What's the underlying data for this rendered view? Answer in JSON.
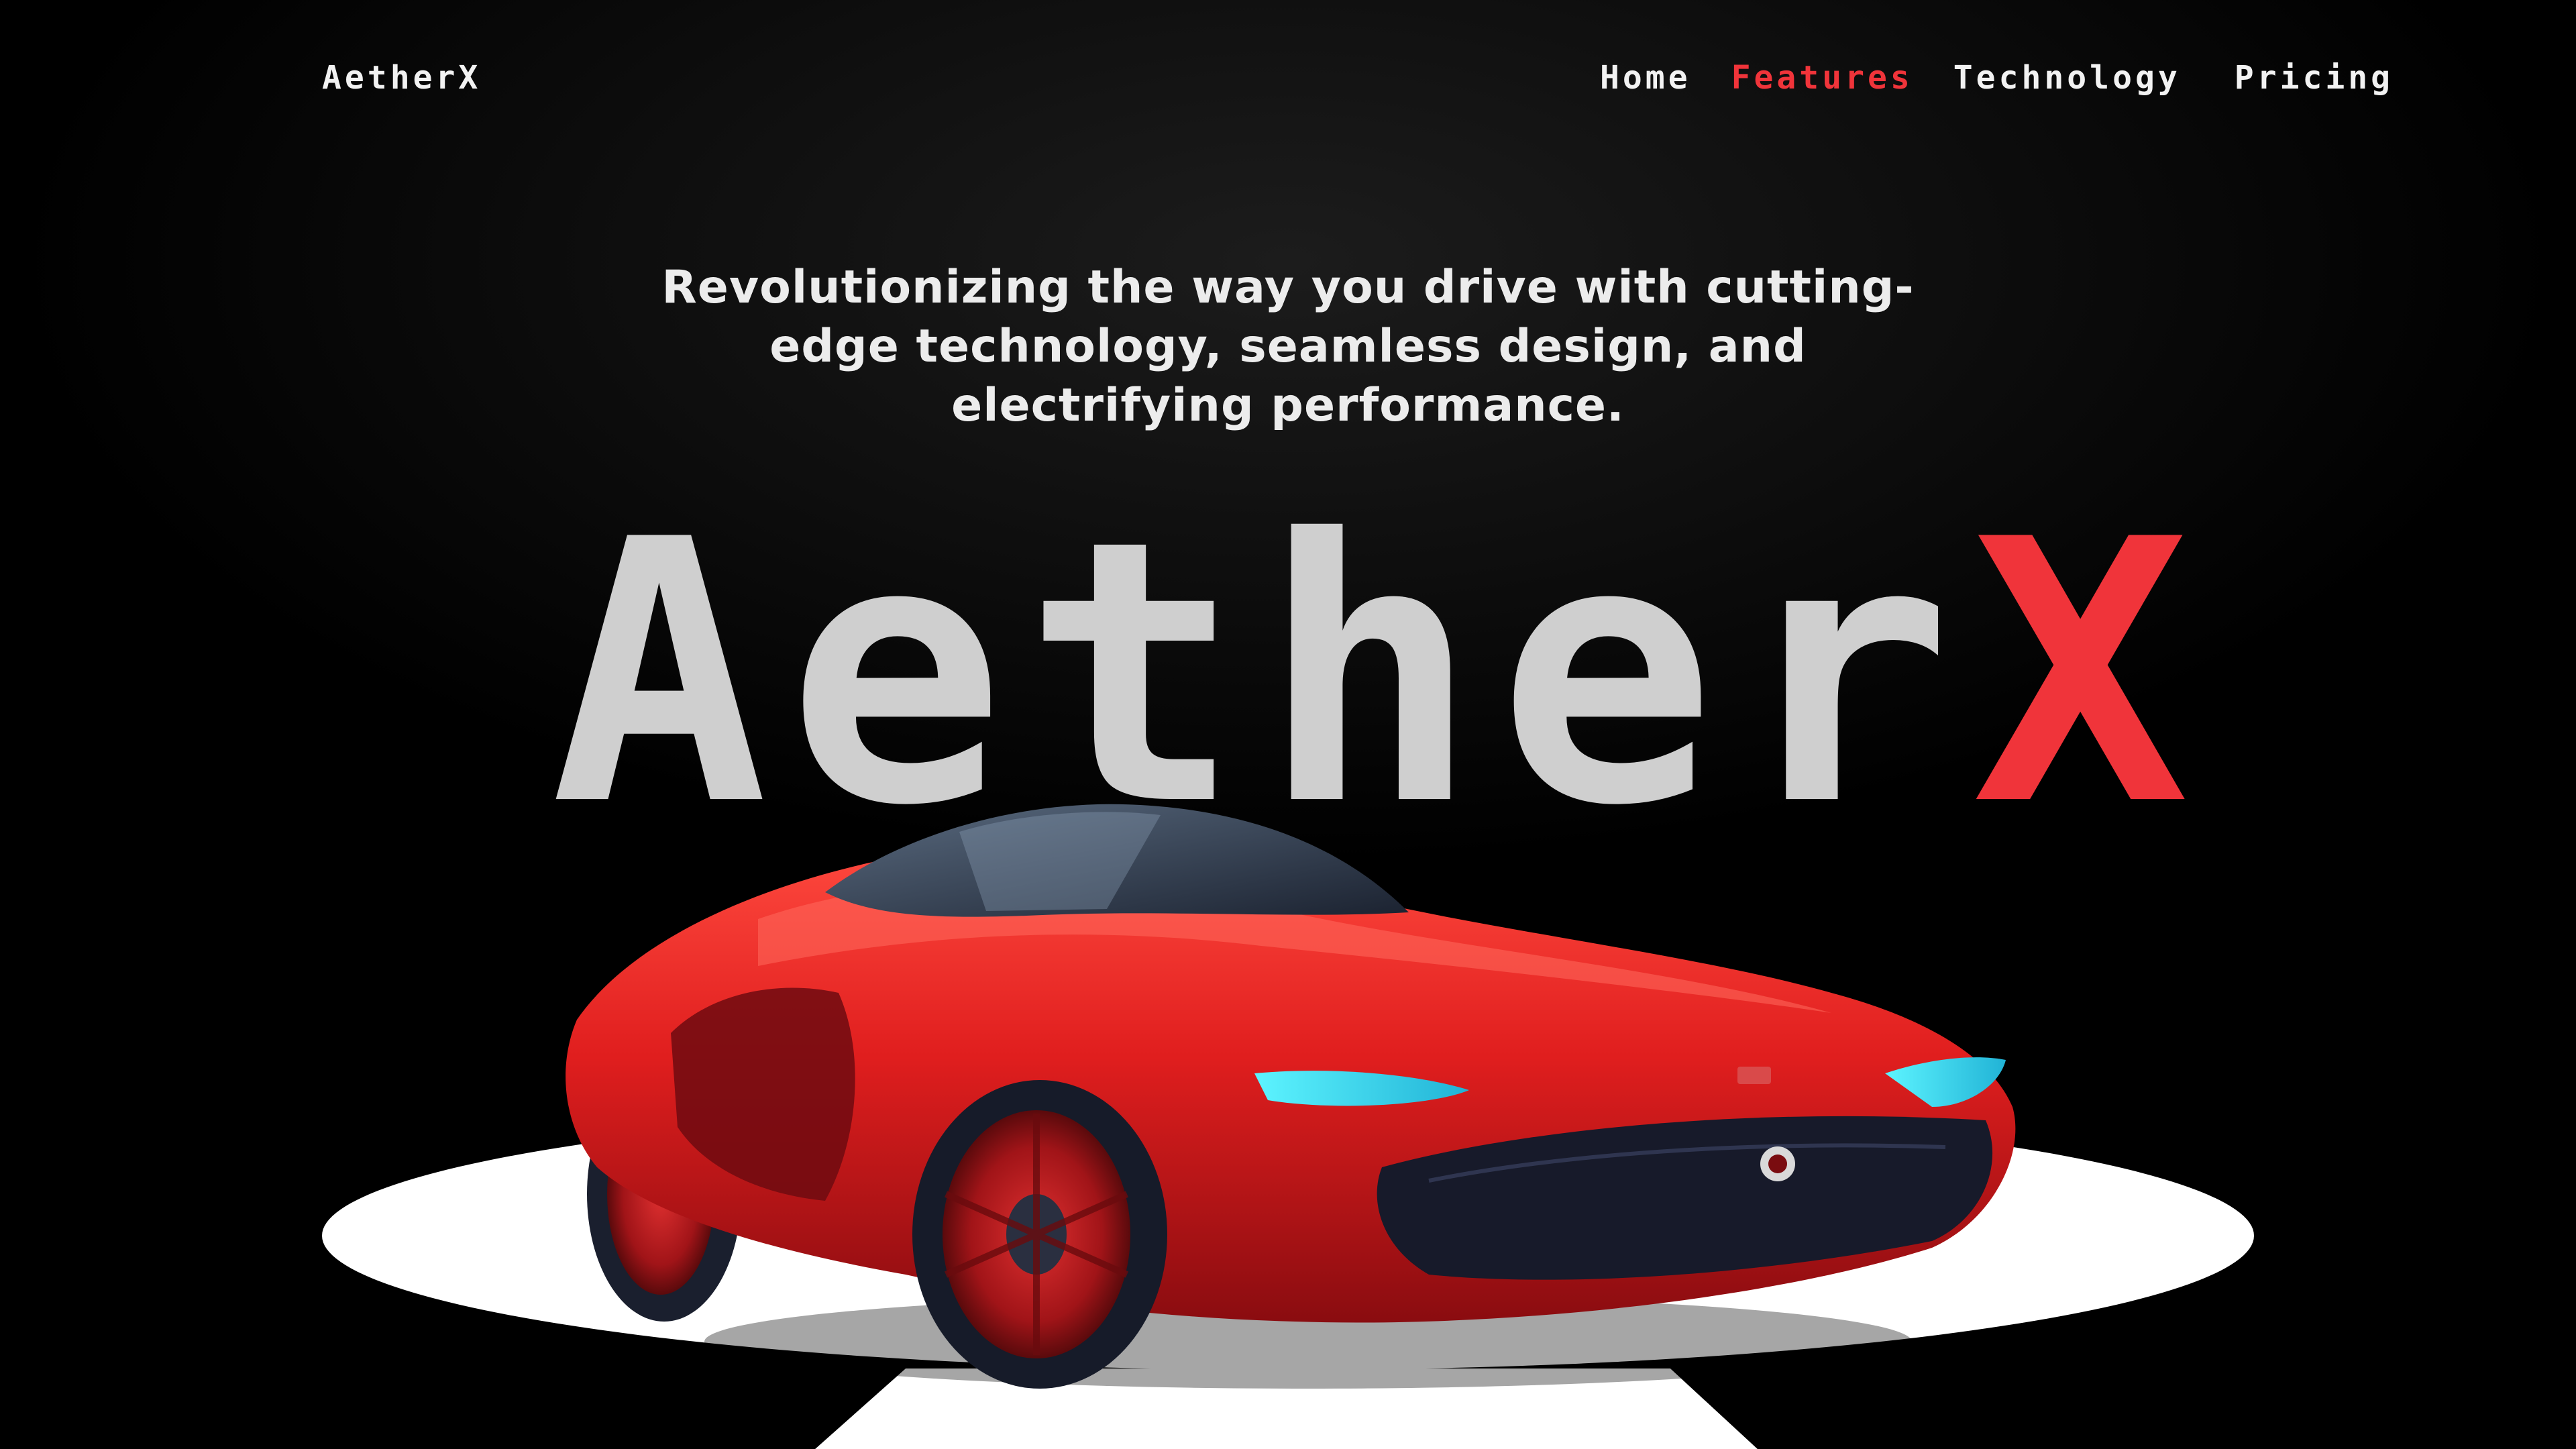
{
  "header": {
    "logo": "AetherX"
  },
  "nav": {
    "items": [
      {
        "label": "Home",
        "active": false
      },
      {
        "label": "Features",
        "active": true
      },
      {
        "label": "Technology",
        "active": false
      },
      {
        "label": "Pricing",
        "active": false
      }
    ]
  },
  "hero": {
    "tagline": "Revolutionizing the way you drive with cutting-edge technology, seamless design, and electrifying performance.",
    "title_main": "Aether",
    "title_accent": "X"
  },
  "colors": {
    "background": "#000000",
    "accent": "#f0343a",
    "title_gray": "#cfcfcf",
    "platform": "#ffffff"
  }
}
